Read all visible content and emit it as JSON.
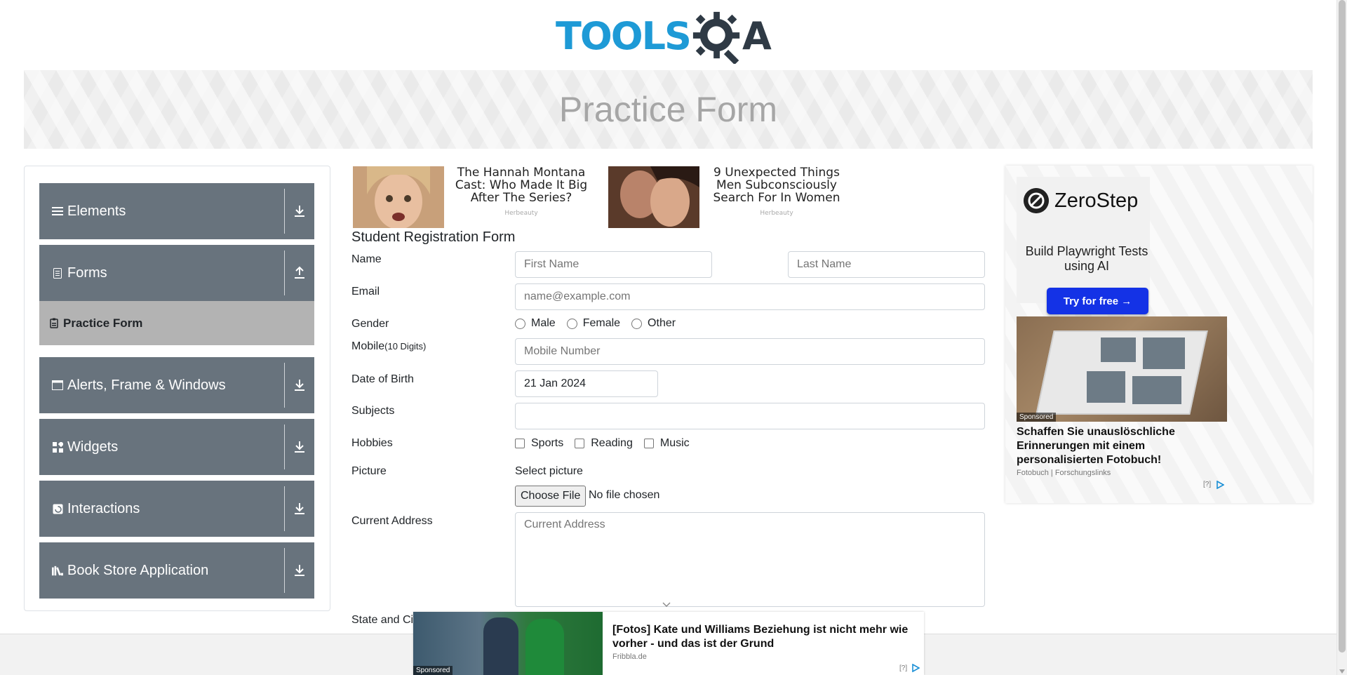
{
  "header": {
    "logo_text": "TOOLS",
    "logo_suffix": "A"
  },
  "banner": {
    "title": "Practice Form"
  },
  "sidebar": {
    "groups": [
      {
        "label": "Elements",
        "icon": "list-icon"
      },
      {
        "label": "Forms",
        "icon": "document-icon",
        "expanded": true,
        "items": [
          {
            "label": "Practice Form",
            "icon": "form-icon",
            "active": true
          }
        ]
      },
      {
        "label": "Alerts, Frame & Windows",
        "icon": "window-icon"
      },
      {
        "label": "Widgets",
        "icon": "widgets-icon"
      },
      {
        "label": "Interactions",
        "icon": "interactions-icon"
      },
      {
        "label": "Book Store Application",
        "icon": "books-icon"
      }
    ]
  },
  "top_ads": [
    {
      "title": "The Hannah Montana Cast: Who Made It Big After The Series?",
      "source": "Herbeauty"
    },
    {
      "title": "9 Unexpected Things Men Subconsciously Search For In Women",
      "source": "Herbeauty"
    }
  ],
  "form": {
    "title": "Student Registration Form",
    "name_label": "Name",
    "first_name_placeholder": "First Name",
    "last_name_placeholder": "Last Name",
    "email_label": "Email",
    "email_placeholder": "name@example.com",
    "gender_label": "Gender",
    "gender_options": [
      "Male",
      "Female",
      "Other"
    ],
    "mobile_label": "Mobile",
    "mobile_hint": "(10 Digits)",
    "mobile_placeholder": "Mobile Number",
    "dob_label": "Date of Birth",
    "dob_value": "21 Jan 2024",
    "subjects_label": "Subjects",
    "hobbies_label": "Hobbies",
    "hobby_options": [
      "Sports",
      "Reading",
      "Music"
    ],
    "picture_label": "Picture",
    "select_picture": "Select picture",
    "choose_file": "Choose File",
    "file_status": "No file chosen",
    "address_label": "Current Address",
    "address_placeholder": "Current Address",
    "state_city_label": "State and Ci"
  },
  "right_ad": {
    "brand": "ZeroStep",
    "tagline": "Build Playwright Tests using AI",
    "cta": "Try for free →",
    "sponsored": "Sponsored",
    "photo_title": "Schaffen Sie unauslöschliche Erinnerungen mit einem personalisierten Fotobuch!",
    "photo_source": "Fotobuch | Forschungslinks",
    "adchoice": "[?]"
  },
  "bottom_ad": {
    "sponsored": "Sponsored",
    "title": "[Fotos] Kate und Williams Beziehung ist nicht mehr wie vorher - und das ist der Grund",
    "source": "Fribbla.de",
    "adchoice": "[?]"
  },
  "colors": {
    "accent": "#1e9ad6",
    "nav_bg": "#68737d",
    "active_item": "#b3b3b3",
    "cta": "#1432e6"
  }
}
